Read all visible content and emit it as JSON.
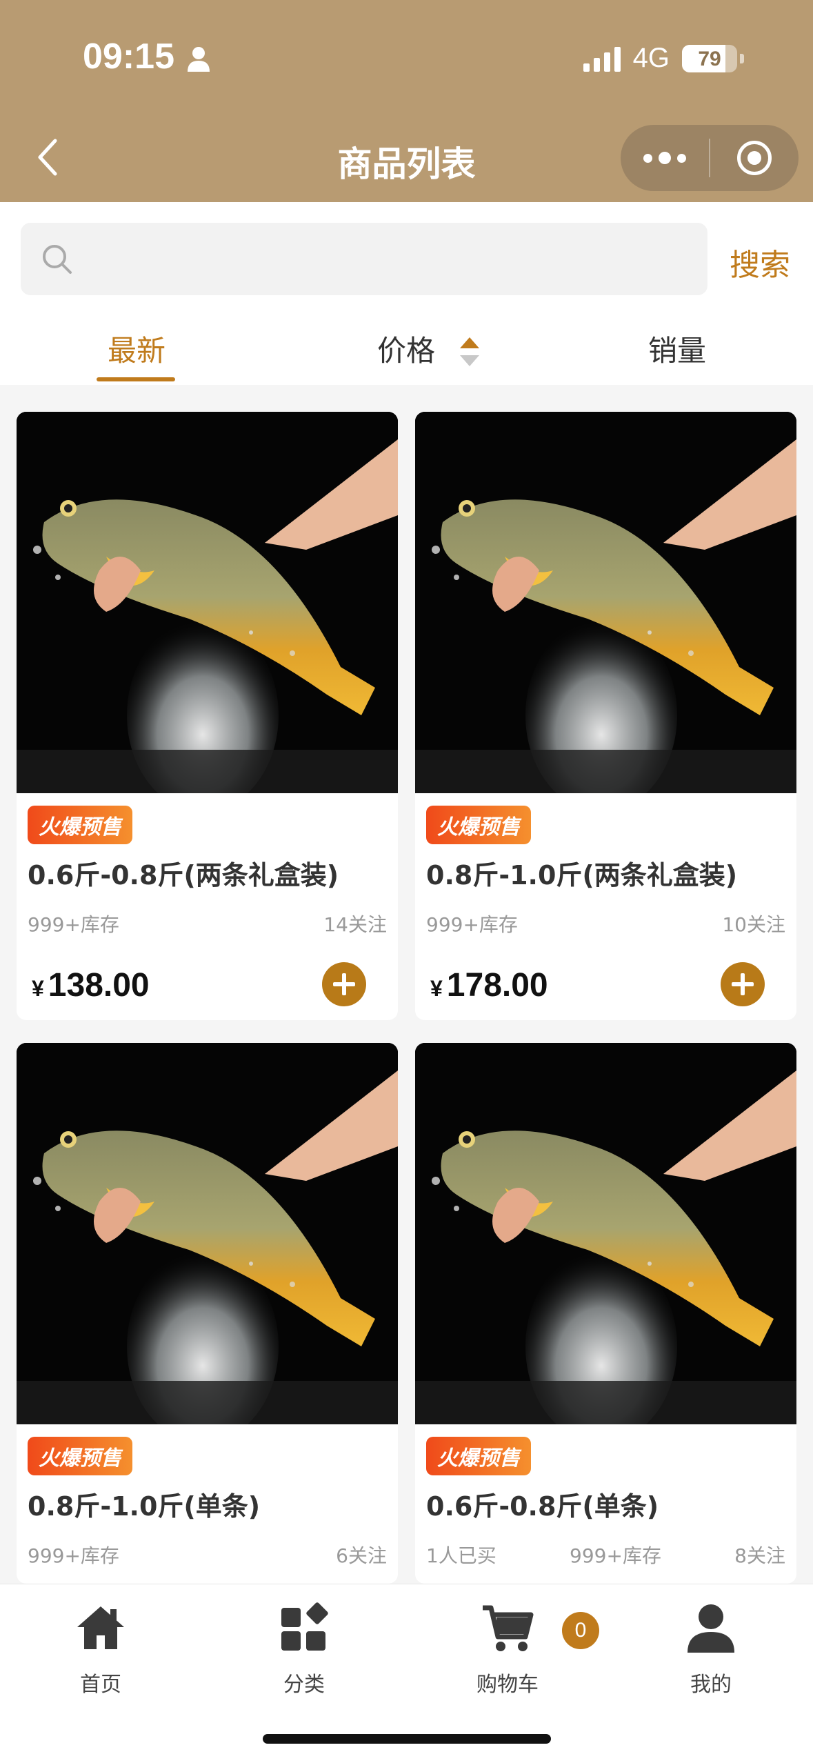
{
  "status_bar": {
    "time": "09:15",
    "network": "4G",
    "battery": "79",
    "battery_level": 0.79
  },
  "nav": {
    "title": "商品列表"
  },
  "search": {
    "placeholder": "",
    "button_label": "搜索"
  },
  "tabs": {
    "newest": "最新",
    "price": "价格",
    "sales": "销量"
  },
  "products": [
    {
      "badge": "火爆预售",
      "name": "0.6斤-0.8斤(两条礼盒装)",
      "stock": "999+库存",
      "follows": "14关注",
      "currency": "¥",
      "price": "138.00"
    },
    {
      "badge": "火爆预售",
      "name": "0.8斤-1.0斤(两条礼盒装)",
      "stock": "999+库存",
      "follows": "10关注",
      "currency": "¥",
      "price": "178.00"
    },
    {
      "badge": "火爆预售",
      "name": "0.8斤-1.0斤(单条)",
      "stock": "999+库存",
      "follows": "6关注"
    },
    {
      "badge": "火爆预售",
      "name": "0.6斤-0.8斤(单条)",
      "bought": "1人已买",
      "stock": "999+库存",
      "follows": "8关注"
    }
  ],
  "tabbar": {
    "home": "首页",
    "category": "分类",
    "cart": "购物车",
    "cart_count": "0",
    "mine": "我的"
  },
  "colors": {
    "header": "#b89b72",
    "accent": "#c07b1c",
    "badge_start": "#f04a1a",
    "badge_end": "#f5902e"
  }
}
